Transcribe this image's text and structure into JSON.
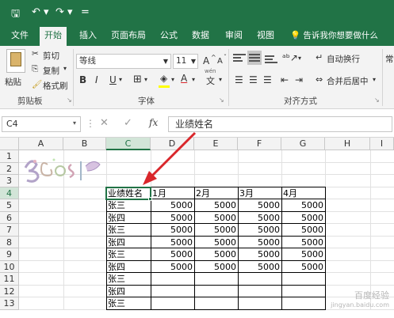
{
  "qat": {
    "save": "🖫",
    "undo": "↶ ▾",
    "redo": "↷ ▾",
    "more": "="
  },
  "tabs": [
    "文件",
    "开始",
    "插入",
    "页面布局",
    "公式",
    "数据",
    "审阅",
    "视图"
  ],
  "active_tab": "开始",
  "tell_me": "告诉我你想要做什么",
  "clipboard": {
    "paste": "粘贴",
    "cut": "剪切",
    "copy": "复制",
    "copy_arrow": "▾",
    "format_painter": "格式刷",
    "label": "剪贴板"
  },
  "font": {
    "name": "等线",
    "size": "11",
    "grow": "A",
    "shrink": "A",
    "bold": "B",
    "italic": "I",
    "underline": "U",
    "label": "字体",
    "phonetic": "wén"
  },
  "alignment": {
    "wrap": "自动换行",
    "merge": "合并后居中",
    "label": "对齐方式"
  },
  "number_partial": "常",
  "formula_bar": {
    "name_box": "C4",
    "cancel": "✕",
    "enter": "✓",
    "fx": "fx",
    "content": "业绩姓名"
  },
  "columns": [
    "A",
    "B",
    "C",
    "D",
    "E",
    "F",
    "G",
    "H",
    "I"
  ],
  "rows": [
    "1",
    "2",
    "3",
    "4",
    "5",
    "6",
    "7",
    "8",
    "9",
    "10",
    "11",
    "12",
    "13"
  ],
  "table": {
    "header": [
      "业绩姓名",
      "1月",
      "2月",
      "3月",
      "4月"
    ],
    "rows": [
      [
        "张三",
        "5000",
        "5000",
        "5000",
        "5000"
      ],
      [
        "张四",
        "5000",
        "5000",
        "5000",
        "5000"
      ],
      [
        "张三",
        "5000",
        "5000",
        "5000",
        "5000"
      ],
      [
        "张四",
        "5000",
        "5000",
        "5000",
        "5000"
      ],
      [
        "张三",
        "5000",
        "5000",
        "5000",
        "5000"
      ],
      [
        "张四",
        "5000",
        "5000",
        "5000",
        "5000"
      ],
      [
        "张三",
        "",
        "",
        "",
        ""
      ],
      [
        "张四",
        "",
        "",
        "",
        ""
      ],
      [
        "张三",
        "",
        "",
        "",
        ""
      ]
    ]
  },
  "watermark": "百度经验",
  "watermark_url": "jingyan.baidu.com",
  "colors": {
    "excel_green": "#217346",
    "arrow": "#d9262b",
    "selection": "#d2e5d8"
  }
}
